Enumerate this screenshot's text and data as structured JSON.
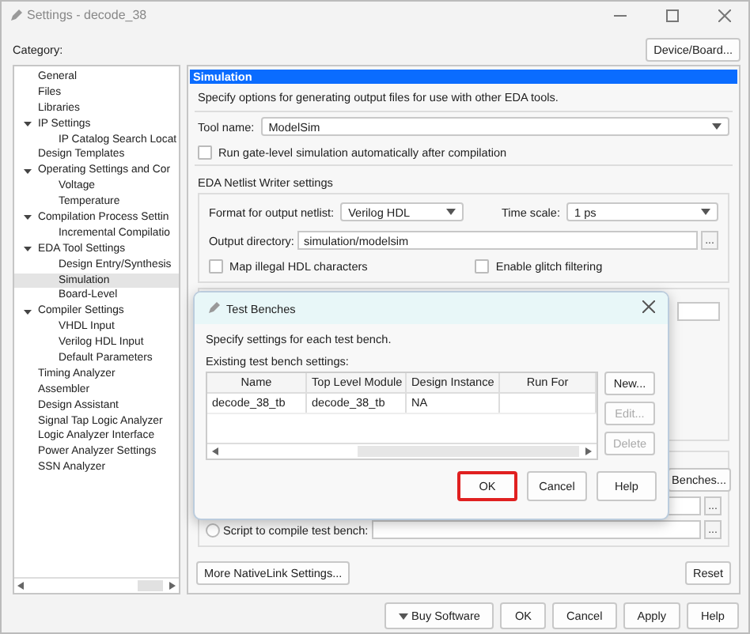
{
  "window": {
    "title": "Settings - decode_38"
  },
  "category_label": "Category:",
  "device_board_button": "Device/Board...",
  "tree": [
    {
      "label": "General",
      "selected": false
    },
    {
      "label": "Files",
      "selected": false
    },
    {
      "label": "Libraries",
      "selected": false
    },
    {
      "label": "IP Settings",
      "selected": false,
      "expanded": true,
      "children": [
        {
          "label": "IP Catalog Search Locat",
          "selected": false
        }
      ]
    },
    {
      "label": "Design Templates",
      "selected": false
    },
    {
      "label": "Operating Settings and Cor",
      "selected": false,
      "expanded": true,
      "children": [
        {
          "label": "Voltage",
          "selected": false
        },
        {
          "label": "Temperature",
          "selected": false
        }
      ]
    },
    {
      "label": "Compilation Process Settin",
      "selected": false,
      "expanded": true,
      "children": [
        {
          "label": "Incremental Compilatio",
          "selected": false
        }
      ]
    },
    {
      "label": "EDA Tool Settings",
      "selected": false,
      "expanded": true,
      "children": [
        {
          "label": "Design Entry/Synthesis",
          "selected": false
        },
        {
          "label": "Simulation",
          "selected": true
        },
        {
          "label": "Board-Level",
          "selected": false
        }
      ]
    },
    {
      "label": "Compiler Settings",
      "selected": false,
      "expanded": true,
      "children": [
        {
          "label": "VHDL Input",
          "selected": false
        },
        {
          "label": "Verilog HDL Input",
          "selected": false
        },
        {
          "label": "Default Parameters",
          "selected": false
        }
      ]
    },
    {
      "label": "Timing Analyzer",
      "selected": false
    },
    {
      "label": "Assembler",
      "selected": false
    },
    {
      "label": "Design Assistant",
      "selected": false
    },
    {
      "label": "Signal Tap Logic Analyzer",
      "selected": false
    },
    {
      "label": "Logic Analyzer Interface",
      "selected": false
    },
    {
      "label": "Power Analyzer Settings",
      "selected": false
    },
    {
      "label": "SSN Analyzer",
      "selected": false
    }
  ],
  "page": {
    "header": "Simulation",
    "description": "Specify options for generating output files for use with other EDA tools.",
    "tool_name": {
      "label": "Tool name:",
      "value": "ModelSim"
    },
    "run_gate_level": {
      "label": "Run gate-level simulation automatically after compilation",
      "checked": false
    },
    "netlist_heading": "EDA Netlist Writer settings",
    "format": {
      "label": "Format for output netlist:",
      "value": "Verilog HDL"
    },
    "time_scale": {
      "label": "Time scale:",
      "value": "1 ps"
    },
    "output_directory": {
      "label": "Output directory:",
      "value": "simulation/modelsim",
      "browse": "..."
    },
    "map_illegal": {
      "label": "Map illegal HDL characters",
      "checked": false
    },
    "glitch": {
      "label": "Enable glitch filtering",
      "checked": false
    },
    "test_benches_button": "Benches...",
    "bench_browse": "...",
    "script": {
      "label": "Script to compile test bench:",
      "selected": false,
      "browse": "..."
    },
    "more_button": "More NativeLink Settings...",
    "reset_button": "Reset"
  },
  "footer_buttons": [
    {
      "label": "Buy Software",
      "kind": "menu"
    },
    {
      "label": "OK",
      "kind": "plain"
    },
    {
      "label": "Cancel",
      "kind": "plain"
    },
    {
      "label": "Apply",
      "kind": "plain"
    },
    {
      "label": "Help",
      "kind": "plain"
    }
  ],
  "dialog": {
    "title": "Test Benches",
    "description": "Specify settings for each test bench.",
    "list_label": "Existing test bench settings:",
    "columns": [
      "Name",
      "Top Level Module",
      "Design Instance",
      "Run For"
    ],
    "rows": [
      {
        "cells": [
          "decode_38_tb",
          "decode_38_tb",
          "NA"
        ]
      }
    ],
    "side_buttons": [
      {
        "label": "New...",
        "disabled": false
      },
      {
        "label": "Edit...",
        "disabled": true
      },
      {
        "label": "Delete",
        "disabled": true
      }
    ],
    "buttons": [
      {
        "label": "OK",
        "highlighted": true
      },
      {
        "label": "Cancel",
        "highlighted": false
      },
      {
        "label": "Help",
        "highlighted": false
      }
    ]
  }
}
